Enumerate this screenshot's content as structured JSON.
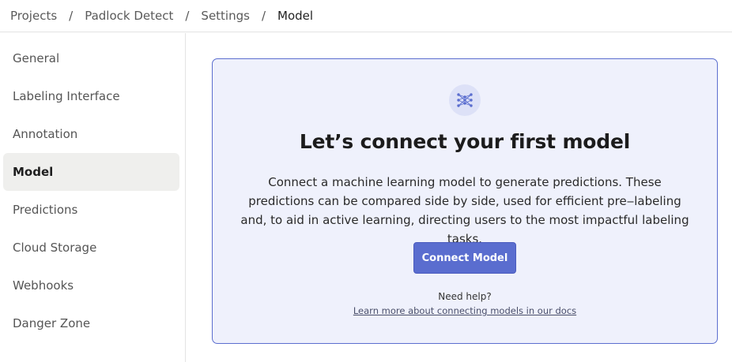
{
  "breadcrumb": {
    "items": [
      {
        "label": "Projects"
      },
      {
        "label": "Padlock Detect"
      },
      {
        "label": "Settings"
      },
      {
        "label": "Model"
      }
    ],
    "separator": "/"
  },
  "sidebar": {
    "items": [
      {
        "label": "General",
        "active": false
      },
      {
        "label": "Labeling Interface",
        "active": false
      },
      {
        "label": "Annotation",
        "active": false
      },
      {
        "label": "Model",
        "active": true
      },
      {
        "label": "Predictions",
        "active": false
      },
      {
        "label": "Cloud Storage",
        "active": false
      },
      {
        "label": "Webhooks",
        "active": false
      },
      {
        "label": "Danger Zone",
        "active": false
      }
    ]
  },
  "model_empty_state": {
    "icon": "neural-network-icon",
    "title": "Let’s connect your first model",
    "description": "Connect a machine learning model to generate predictions. These predictions can be compared side by side, used for efficient pre‒labeling and, to aid in active learning, directing users to the most impactful labeling tasks.",
    "connect_button_label": "Connect Model",
    "help_text": "Need help?",
    "help_link_text": "Learn more about connecting models in our docs"
  },
  "colors": {
    "accent": "#5a6dcf",
    "card_background": "#eff1fc",
    "card_border": "#5b6ecf",
    "active_sidebar_bg": "#efefed"
  }
}
